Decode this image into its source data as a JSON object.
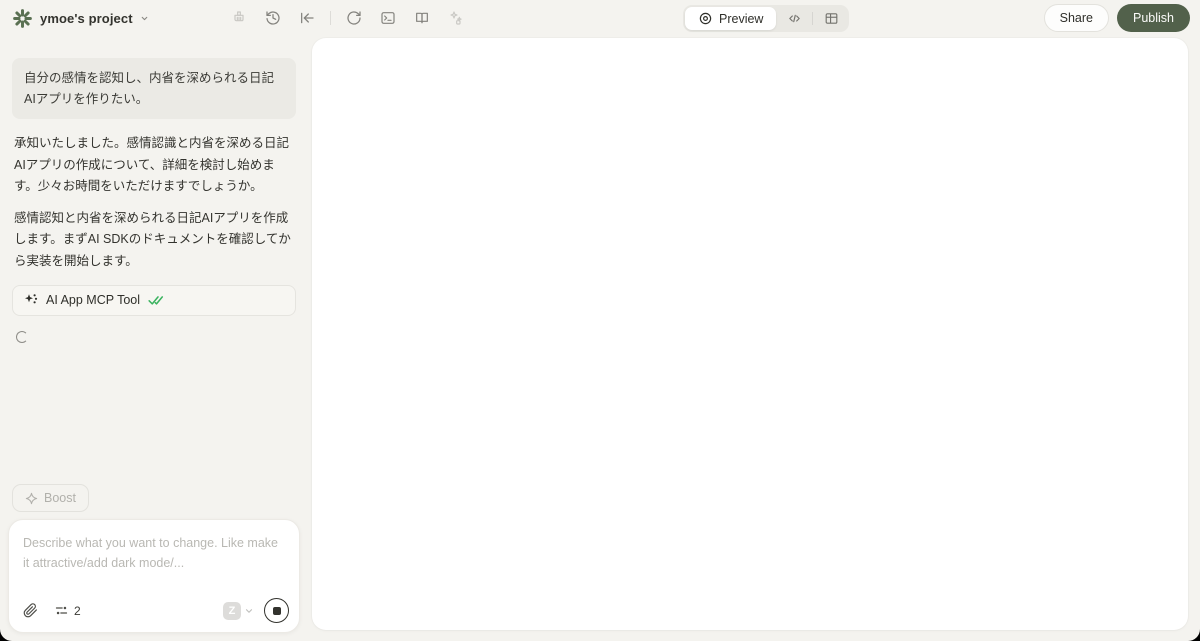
{
  "topbar": {
    "project_name": "ymoe's project",
    "icons": [
      "brush-icon",
      "history-icon",
      "collapse-left-icon",
      "refresh-icon",
      "terminal-icon",
      "book-open-icon",
      "sparkles-icon"
    ],
    "view_toggle": {
      "preview_label": "Preview",
      "icons": [
        "eye-icon",
        "code-icon",
        "grid-icon"
      ]
    },
    "share_label": "Share",
    "publish_label": "Publish"
  },
  "colors": {
    "background": "#f4f3ef",
    "publish_green": "#52614b",
    "logo_green": "#5a7052",
    "check_green": "#3ab35f"
  },
  "chat": {
    "user_message": "自分の感情を認知し、内省を深められる日記AIアプリを作りたい。",
    "assistant_paragraphs": [
      "承知いたしました。感情認識と内省を深める日記AIアプリの作成について、詳細を検討し始めます。少々お時間をいただけますでしょうか。",
      "感情認知と内省を深められる日記AIアプリを作成します。まずAI SDKのドキュメントを確認してから実装を開始します。"
    ],
    "tool_card": {
      "label": "AI App MCP Tool",
      "status_icon": "double-check-icon"
    },
    "loading": true,
    "boost_label": "Boost",
    "composer": {
      "placeholder": "Describe what you want to change. Like make it attractive/add dark mode/...",
      "context_count": "2",
      "model_badge": "Z"
    }
  }
}
